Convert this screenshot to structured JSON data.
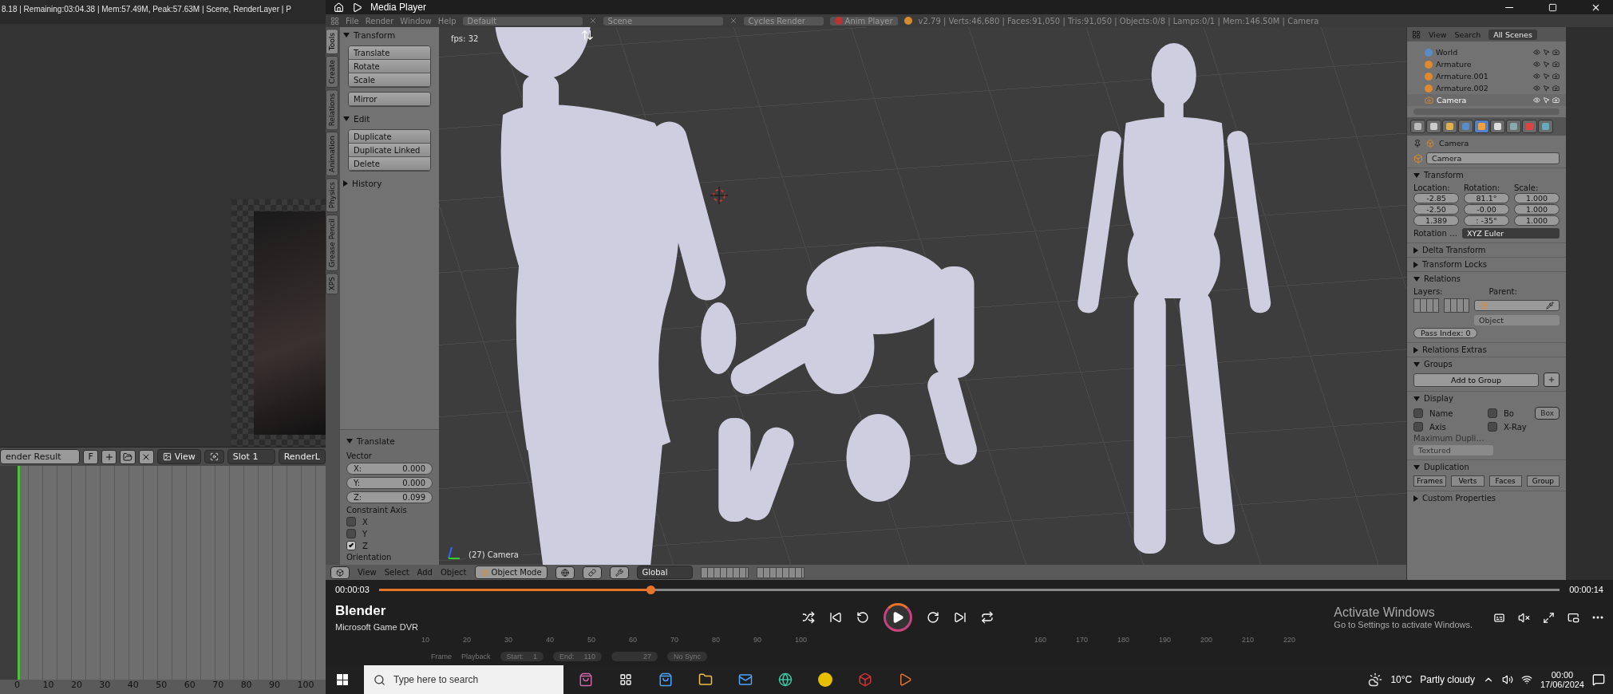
{
  "status_line": "8.18 | Remaining:03:04.38 | Mem:57.49M, Peak:57.63M | Scene, RenderLayer | P",
  "image_editor": {
    "image_name": "ender Result",
    "fake_user": "F",
    "view_menu": "View",
    "slot": "Slot 1",
    "render_layer": "RenderL",
    "ruler": [
      "0",
      "10",
      "20",
      "30",
      "40",
      "50",
      "60",
      "70",
      "80",
      "90",
      "100"
    ]
  },
  "media_player": {
    "title": "Media Player",
    "blender_header": {
      "menus": [
        "File",
        "Render",
        "Window",
        "Help"
      ],
      "layout": "Default",
      "scene": "Scene",
      "engine": "Cycles Render",
      "anim_player": "Anim Player",
      "stats": "v2.79 | Verts:46,680 | Faces:91,050 | Tris:91,050 | Objects:0/8 | Lamps:0/1 | Mem:146.50M | Camera"
    },
    "tool_tabs": [
      {
        "label": "Tools",
        "selected": true
      },
      {
        "label": "Create",
        "selected": false
      },
      {
        "label": "Relations",
        "selected": false
      },
      {
        "label": "Animation",
        "selected": false
      },
      {
        "label": "Physics",
        "selected": false
      },
      {
        "label": "Grease Pencil",
        "selected": false
      },
      {
        "label": "XPS",
        "selected": false
      }
    ],
    "tool_panels": [
      {
        "title": "Transform",
        "expanded": true,
        "button_groups": [
          [
            "Translate",
            "Rotate",
            "Scale"
          ],
          [
            "Mirror"
          ]
        ]
      },
      {
        "title": "Edit",
        "expanded": true,
        "button_groups": [
          [
            "Duplicate",
            "Duplicate Linked",
            "Delete"
          ]
        ]
      },
      {
        "title": "History",
        "expanded": false
      }
    ],
    "operator": {
      "title": "Translate",
      "expanded": true,
      "vector_label": "Vector",
      "vector": [
        {
          "axis": "X:",
          "value": "0.000"
        },
        {
          "axis": "Y:",
          "value": "0.000"
        },
        {
          "axis": "Z:",
          "value": "0.099"
        }
      ],
      "constraint_label": "Constraint Axis",
      "constraints": [
        {
          "label": "X",
          "checked": false
        },
        {
          "label": "Y",
          "checked": false
        },
        {
          "label": "Z",
          "checked": true
        }
      ],
      "orientation_label": "Orientation"
    },
    "viewport": {
      "fps": "fps: 32",
      "object_label": "(27) Camera"
    },
    "viewport_header": {
      "menus": [
        "View",
        "Select",
        "Add",
        "Object"
      ],
      "mode": "Object Mode",
      "orientation": "Global"
    },
    "outliner": {
      "menus": [
        "View",
        "Search"
      ],
      "scope": "All Scenes",
      "items": [
        {
          "name": "World",
          "kind": "world",
          "selected": false
        },
        {
          "name": "Armature",
          "kind": "armature",
          "selected": false
        },
        {
          "name": "Armature.001",
          "kind": "armature",
          "selected": false
        },
        {
          "name": "Armature.002",
          "kind": "armature",
          "selected": false
        },
        {
          "name": "Camera",
          "kind": "camera",
          "selected": true
        }
      ]
    },
    "properties": {
      "tabs": [
        {
          "kind": "render",
          "selected": false
        },
        {
          "kind": "layers",
          "selected": false
        },
        {
          "kind": "scene",
          "selected": false
        },
        {
          "kind": "world",
          "selected": false
        },
        {
          "kind": "object",
          "selected": true
        },
        {
          "kind": "constraints",
          "selected": false
        },
        {
          "kind": "modifiers",
          "selected": false
        },
        {
          "kind": "material",
          "selected": false
        },
        {
          "kind": "data",
          "selected": false
        }
      ],
      "breadcrumb": "Camera",
      "object_name": "Camera",
      "sections": [
        {
          "kind": "transform",
          "title": "Transform",
          "expanded": true,
          "columns": [
            {
              "label": "Location:",
              "values": [
                "-2.85",
                "-2.50",
                "1.389"
              ]
            },
            {
              "label": "Rotation:",
              "values": [
                "81.1°",
                "-0.00",
                ": -35°"
              ]
            },
            {
              "label": "Scale:",
              "values": [
                "1.000",
                "1.000",
                "1.000"
              ]
            }
          ],
          "mode_label": "Rotation …",
          "mode": "XYZ Euler"
        },
        {
          "kind": "plain",
          "title": "Delta Transform",
          "expanded": false
        },
        {
          "kind": "plain",
          "title": "Transform Locks",
          "expanded": false
        },
        {
          "kind": "relations",
          "title": "Relations",
          "expanded": true,
          "layers_label": "Layers:",
          "parent_label": "Parent:",
          "parent_type": "Object",
          "pass_index": "Pass Index: 0"
        },
        {
          "kind": "plain",
          "title": "Relations Extras",
          "expanded": false
        },
        {
          "kind": "groups",
          "title": "Groups",
          "expanded": true,
          "button": "Add to Group"
        },
        {
          "kind": "display",
          "title": "Display",
          "expanded": true,
          "options": [
            {
              "label": "Name",
              "checked": false
            },
            {
              "label": "Bo",
              "checked": false
            },
            {
              "label": "Axis",
              "checked": false
            },
            {
              "label": "X-Ray",
              "checked": false
            }
          ],
          "bounds_type": "Box",
          "max_label": "Maximum Dupli…",
          "draw_type": "Textured"
        },
        {
          "kind": "duplication",
          "title": "Duplication",
          "expanded": true,
          "modes": [
            {
              "label": "Frames",
              "selected": false
            },
            {
              "label": "Verts",
              "selected": false
            },
            {
              "label": "Faces",
              "selected": false
            },
            {
              "label": "Group",
              "selected": false
            }
          ]
        },
        {
          "kind": "plain",
          "title": "Custom Properties",
          "expanded": false
        }
      ]
    },
    "playback": {
      "elapsed": "00:00:03",
      "total": "00:00:14",
      "level": 0.23,
      "title": "Blender",
      "subtitle": "Microsoft Game DVR"
    },
    "activation": {
      "title": "Activate Windows",
      "text": "Go to Settings to activate Windows."
    },
    "timeline": {
      "ruler": [
        "10",
        "20",
        "30",
        "40",
        "50",
        "60",
        "70",
        "80",
        "90",
        "100",
        "160",
        "170",
        "180",
        "190",
        "200",
        "210",
        "220"
      ],
      "menus": [
        "Frame",
        "Playback"
      ],
      "start_label": "Start:",
      "start": "1",
      "end_label": "End:",
      "end": "110",
      "current": "27",
      "sync": "No Sync"
    }
  },
  "taskbar": {
    "search_placeholder": "Type here to search",
    "temperature": "10°C",
    "weather": "Partly cloudy",
    "time": "00:00",
    "date": "17/06/2024"
  }
}
